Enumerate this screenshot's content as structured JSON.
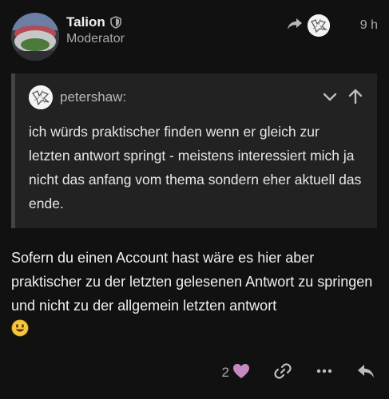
{
  "post": {
    "author": {
      "username": "Talion",
      "title": "Moderator",
      "avatar": "stadium-avatar"
    },
    "reply_to_icon": "share-arrow-icon",
    "age": "9 h"
  },
  "quote": {
    "username": "petershaw:",
    "text": "ich würds praktischer finden wenn er gleich zur letzten antwort springt - meistens interessiert mich ja nicht das anfang vom thema sondern eher aktuell das ende.",
    "controls": [
      "chevron-down-icon",
      "arrow-up-icon"
    ]
  },
  "body": {
    "text": "Sofern du einen Account hast wäre es hier aber praktischer zu der letzten gelesenen Antwort zu springen und nicht zu der allgemein letzten antwort"
  },
  "actions": {
    "like_count": "2",
    "like_color": "#c58ac2"
  },
  "colors": {
    "background": "#111111",
    "quote_background": "#222222",
    "muted_text": "#a9a9a9"
  }
}
